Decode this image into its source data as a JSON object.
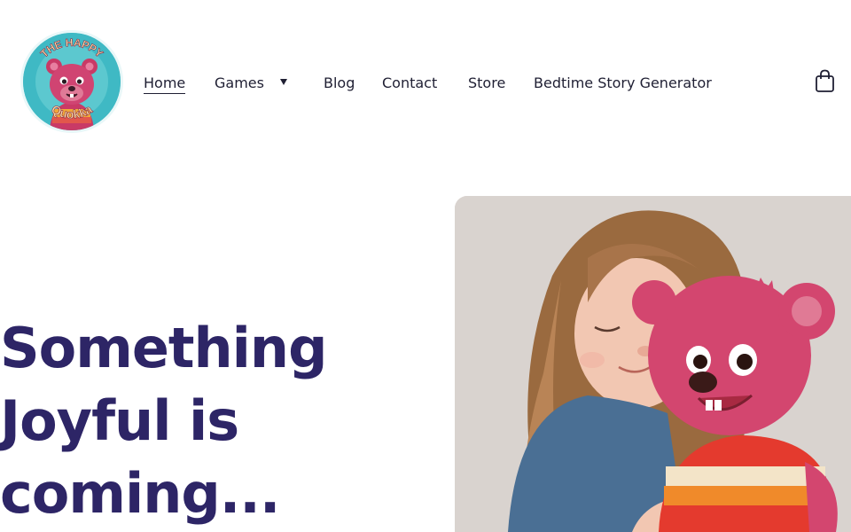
{
  "brand": {
    "logo_text_top": "THE HAPPY",
    "logo_text_bottom": "Quokka",
    "logo_colors": {
      "ring": "#3fb9c4",
      "character": "#c93a66",
      "text": "#f7e3a6"
    }
  },
  "nav": {
    "items": [
      {
        "label": "Home",
        "active": true
      },
      {
        "label": "Games",
        "has_dropdown": true
      },
      {
        "label": "Blog"
      },
      {
        "label": "Contact"
      },
      {
        "label": "Store"
      },
      {
        "label": "Bedtime Story Generator"
      }
    ]
  },
  "header": {
    "cart_icon": "shopping-bag-icon"
  },
  "hero": {
    "title_lines": [
      "Something",
      "Joyful is",
      "coming..."
    ],
    "title_color": "#2d2566"
  }
}
